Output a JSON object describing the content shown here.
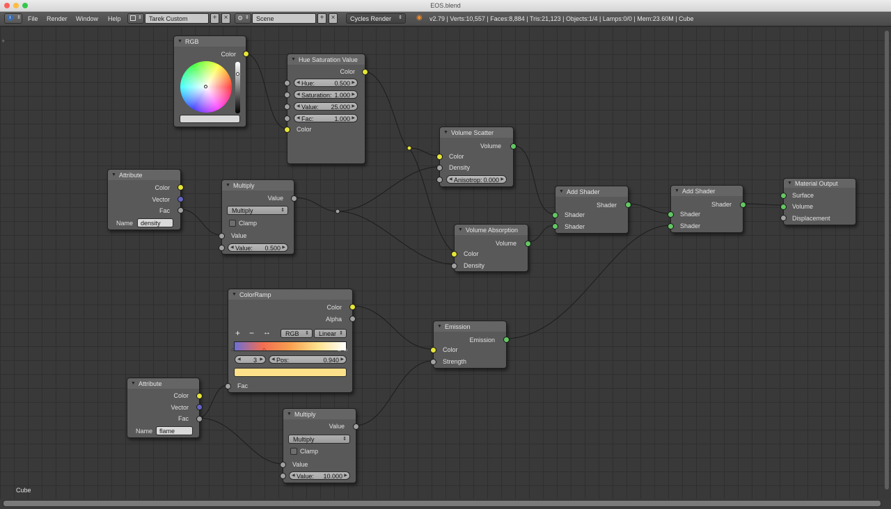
{
  "window": {
    "title": "EOS.blend",
    "controls": [
      "close",
      "minimize",
      "zoom"
    ],
    "control_colors": [
      "#fc605c",
      "#fdbc40",
      "#34c84a"
    ]
  },
  "menu": [
    "File",
    "Render",
    "Window",
    "Help"
  ],
  "screen_layout": "Tarek Custom",
  "scene": "Scene",
  "render_engine": "Cycles Render",
  "info": "v2.79 | Verts:10,557 | Faces:8,884 | Tris:21,123 | Objects:1/4 | Lamps:0/0 | Mem:23.60M | Cube",
  "object_label": "Cube",
  "socket_colors": {
    "color": "#e5e537",
    "shader": "#63c763",
    "vector": "#6464c6",
    "value": "#a1a1a1"
  },
  "nodes": {
    "rgb": {
      "title": "RGB",
      "out_color": "Color",
      "swatch_color": "#d9d9d9"
    },
    "hsv": {
      "title": "Hue Saturation Value",
      "out_color": "Color",
      "hue_label": "Hue:",
      "hue": "0.500",
      "sat_label": "Saturation:",
      "sat": "1.000",
      "val_label": "Value:",
      "val": "25.000",
      "fac_label": "Fac:",
      "fac": "1.000",
      "in_color": "Color"
    },
    "attr1": {
      "title": "Attribute",
      "color": "Color",
      "vector": "Vector",
      "fac": "Fac",
      "name_label": "Name",
      "name": "density"
    },
    "mul1": {
      "title": "Multiply",
      "out": "Value",
      "op": "Multiply",
      "clamp": "Clamp",
      "in_value": "Value",
      "val_label": "Value:",
      "val": "0.500"
    },
    "vscatter": {
      "title": "Volume Scatter",
      "out": "Volume",
      "color": "Color",
      "density": "Density",
      "aniso_label": "Anisotrop:",
      "aniso": "0.000"
    },
    "vabs": {
      "title": "Volume Absorption",
      "out": "Volume",
      "color": "Color",
      "density": "Density"
    },
    "add1": {
      "title": "Add Shader",
      "out": "Shader",
      "in1": "Shader",
      "in2": "Shader"
    },
    "add2": {
      "title": "Add Shader",
      "out": "Shader",
      "in1": "Shader",
      "in2": "Shader"
    },
    "matout": {
      "title": "Material Output",
      "surface": "Surface",
      "volume": "Volume",
      "displacement": "Displacement"
    },
    "ramp": {
      "title": "ColorRamp",
      "out_color": "Color",
      "out_alpha": "Alpha",
      "add": "+",
      "remove": "−",
      "flip": "↔",
      "mode": "RGB",
      "interp": "Linear",
      "index": "3",
      "pos_label": "Pos:",
      "pos": "0.940",
      "fac": "Fac",
      "selected_color": "#fce08a",
      "gradient": [
        "#6b6fd6",
        "#f36d52",
        "#f7a050",
        "#fde28e",
        "#ffffff"
      ]
    },
    "emission": {
      "title": "Emission",
      "out": "Emission",
      "color": "Color",
      "strength": "Strength"
    },
    "attr2": {
      "title": "Attribute",
      "color": "Color",
      "vector": "Vector",
      "fac": "Fac",
      "name_label": "Name",
      "name": "flame"
    },
    "mul2": {
      "title": "Multiply",
      "out": "Value",
      "op": "Multiply",
      "clamp": "Clamp",
      "in_value": "Value",
      "val_label": "Value:",
      "val": "10.000"
    }
  }
}
